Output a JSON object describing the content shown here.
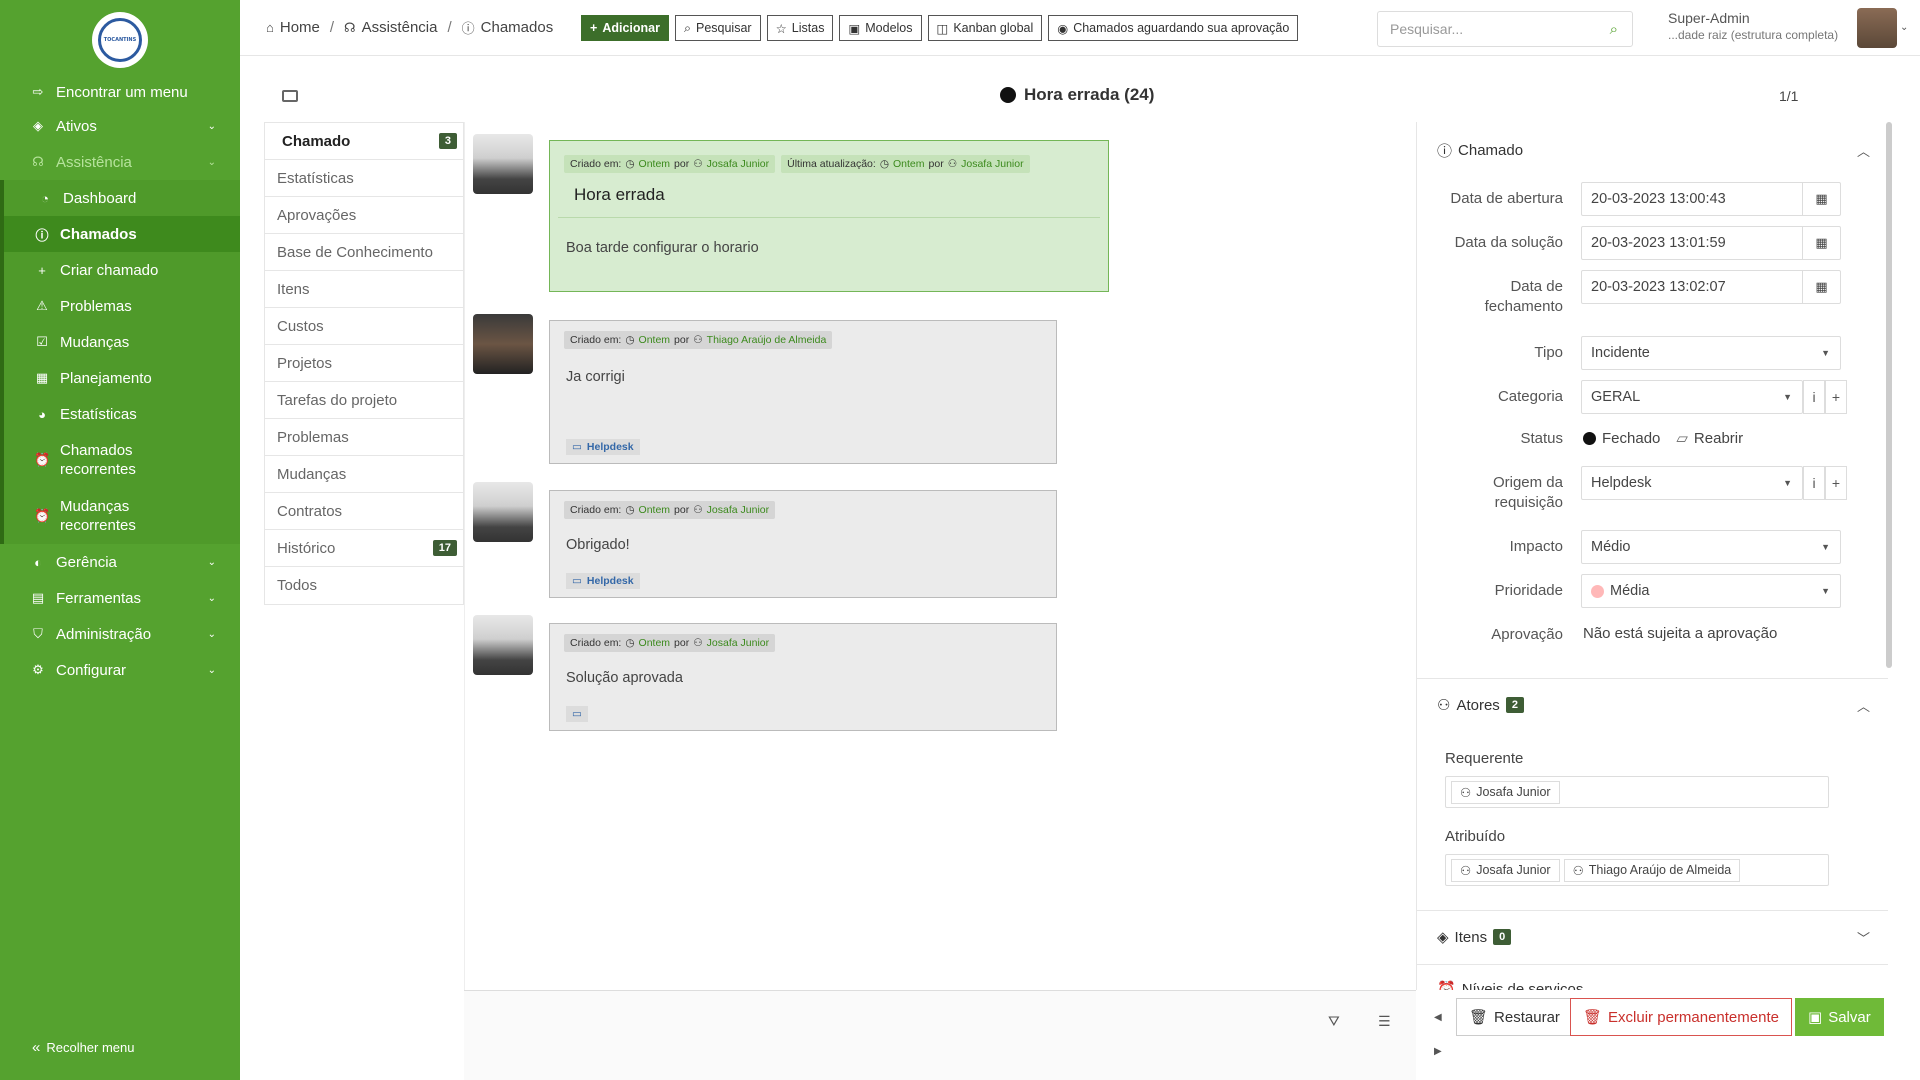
{
  "sidebar": {
    "logo_text": "TOCANTINS",
    "items": [
      {
        "label": "Encontrar um menu"
      },
      {
        "label": "Ativos"
      },
      {
        "label": "Assistência"
      },
      {
        "label": "Gerência"
      },
      {
        "label": "Ferramentas"
      },
      {
        "label": "Administração"
      },
      {
        "label": "Configurar"
      }
    ],
    "submenu": [
      {
        "label": "Dashboard"
      },
      {
        "label": "Chamados"
      },
      {
        "label": "Criar chamado"
      },
      {
        "label": "Problemas"
      },
      {
        "label": "Mudanças"
      },
      {
        "label": "Planejamento"
      },
      {
        "label": "Estatísticas"
      },
      {
        "label": "Chamados recorrentes"
      },
      {
        "label": "Mudanças recorrentes"
      }
    ],
    "collapse_label": "Recolher menu"
  },
  "header": {
    "breadcrumb": [
      "Home",
      "Assistência",
      "Chamados"
    ],
    "buttons": [
      "Adicionar",
      "Pesquisar",
      "Listas",
      "Modelos",
      "Kanban global",
      "Chamados aguardando sua aprovação"
    ],
    "search_placeholder": "Pesquisar...",
    "user_name": "Super-Admin",
    "user_entity": "...dade raiz (estrutura completa)"
  },
  "ticket": {
    "title": "Hora errada (24)",
    "pager": "1/1"
  },
  "tabs": [
    {
      "label": "Chamado",
      "count": "3"
    },
    {
      "label": "Estatísticas"
    },
    {
      "label": "Aprovações"
    },
    {
      "label": "Base de Conhecimento"
    },
    {
      "label": "Itens"
    },
    {
      "label": "Custos"
    },
    {
      "label": "Projetos"
    },
    {
      "label": "Tarefas do projeto"
    },
    {
      "label": "Problemas"
    },
    {
      "label": "Mudanças"
    },
    {
      "label": "Contratos"
    },
    {
      "label": "Histórico",
      "count": "17"
    },
    {
      "label": "Todos"
    }
  ],
  "timeline": {
    "created_label": "Criado em:",
    "updated_label": "Última atualização:",
    "when": "Ontem",
    "by": "por",
    "entries": [
      {
        "author": "Josafa Junior",
        "updated_by": "Josafa Junior",
        "title": "Hora errada",
        "text": "Boa tarde configurar o horario"
      },
      {
        "author": "Thiago Araújo de Almeida",
        "text": "Ja corrigi",
        "source": "Helpdesk"
      },
      {
        "author": "Josafa Junior",
        "text": "Obrigado!",
        "source": "Helpdesk"
      },
      {
        "author": "Josafa Junior",
        "text": "Solução aprovada"
      }
    ]
  },
  "details": {
    "section_title": "Chamado",
    "fields": {
      "opening_label": "Data de abertura",
      "opening_value": "20-03-2023 13:00:43",
      "solution_label": "Data da solução",
      "solution_value": "20-03-2023 13:01:59",
      "closing_label": "Data de fechamento",
      "closing_value": "20-03-2023 13:02:07",
      "type_label": "Tipo",
      "type_value": "Incidente",
      "category_label": "Categoria",
      "category_value": "GERAL",
      "status_label": "Status",
      "status_value": "Fechado",
      "reopen_label": "Reabrir",
      "origin_label": "Origem da requisição",
      "origin_value": "Helpdesk",
      "impact_label": "Impacto",
      "impact_value": "Médio",
      "priority_label": "Prioridade",
      "priority_value": "Média",
      "approval_label": "Aprovação",
      "approval_value": "Não está sujeita a aprovação"
    },
    "actors_title": "Atores",
    "actors_count": "2",
    "requester_label": "Requerente",
    "requesters": [
      "Josafa Junior"
    ],
    "assigned_label": "Atribuído",
    "assigned": [
      "Josafa Junior",
      "Thiago Araújo de Almeida"
    ],
    "items_title": "Itens",
    "items_count": "0",
    "sla_title": "Níveis de serviços"
  },
  "actions": {
    "restore": "Restaurar",
    "delete": "Excluir permanentemente",
    "save": "Salvar"
  },
  "colors": {
    "sidebar": "#55a22f",
    "accent_dark": "#3e5d35",
    "followup_green": "#d7ecd0"
  }
}
